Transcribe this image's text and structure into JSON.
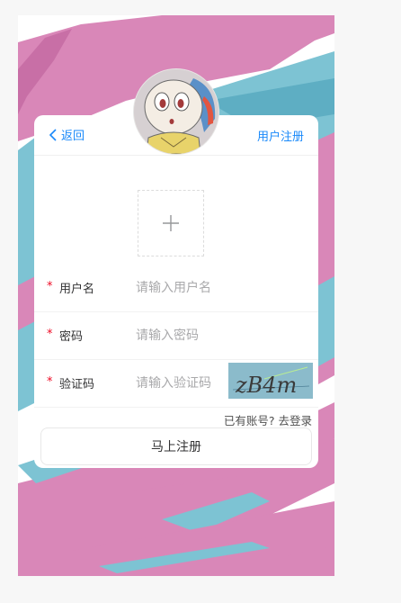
{
  "nav": {
    "back_label": "返回",
    "right_label": "用户注册"
  },
  "form": {
    "username": {
      "label": "用户名",
      "placeholder": "请输入用户名",
      "value": ""
    },
    "password": {
      "label": "密码",
      "placeholder": "请输入密码",
      "value": ""
    },
    "captcha": {
      "label": "验证码",
      "placeholder": "请输入验证码",
      "value": "",
      "image_text": "zB4m"
    },
    "required_mark": "*"
  },
  "login_link": "已有账号? 去登录",
  "submit_label": "马上注册",
  "colors": {
    "accent": "#1989fa",
    "required": "#ee0a24",
    "background_pink": "#d987b8",
    "background_blue": "#7dc3d3"
  }
}
